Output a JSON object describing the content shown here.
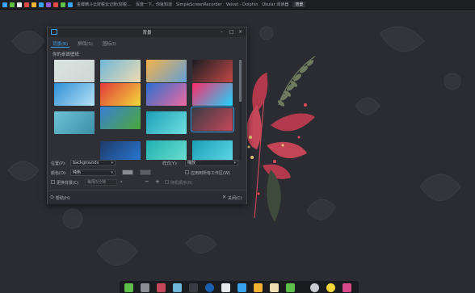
{
  "taskbar": {
    "tasks": [
      "金蝶精斗云财税云记账(财税版)",
      "百度一下，你就知道",
      "SimpleScreenRecorder",
      "Velvet - Dolphin",
      "Okular 阅读器",
      "背景"
    ],
    "active_index": 5,
    "icon_colors": [
      "#3aa3f0",
      "#5fbf4a",
      "#e6e8ec",
      "#e24a4a",
      "#f2b233",
      "#3aa3f0",
      "#8f5bd6",
      "#e24a4a",
      "#5fbf4a",
      "#3aa3f0"
    ]
  },
  "dialog": {
    "title": "背景",
    "tabs": [
      "背景(B)",
      "屏保(S)",
      "图标(I)"
    ],
    "active_tab": 0,
    "section_label": "你的桌面壁纸",
    "thumb_colors": [
      [
        "#d9e4e0",
        "#cfd6d5"
      ],
      [
        "#6fb7d8",
        "#f0dcb1"
      ],
      [
        "#f4b24a",
        "#62a0d8"
      ],
      [
        "#1c1e22",
        "#c24848"
      ],
      [
        "#2f8fd6",
        "#b6e2f6"
      ],
      [
        "#e23a3a",
        "#f2d83a"
      ],
      [
        "#2a6fd0",
        "#f06aa0"
      ],
      [
        "#ff2a6a",
        "#1cd7ff"
      ],
      [
        "#6ec1d6",
        "#3c8fa8"
      ],
      [
        "#3a7fd6",
        "#4aa83a"
      ],
      [
        "#1b9fb6",
        "#6fe0e0"
      ],
      [
        "#3a3c44",
        "#c7475a"
      ],
      [
        "#1e3a6a",
        "#2a7ad6"
      ],
      [
        "#1fb0b0",
        "#6fe0d0"
      ],
      [
        "#1aa0b6",
        "#60d8e6"
      ],
      [
        "#2a2c32",
        "#2a2c32"
      ]
    ],
    "position_label": "位置(P):",
    "position_value": "backgrounds",
    "style_label": "样式(Y):",
    "style_value": "缩放",
    "color_label": "颜色(O):",
    "color_value": "纯色",
    "color1": "#8a8d93",
    "color2": "#5c5f66",
    "all_workspaces_label": "应用到所有工作区(W)",
    "auto_change_label": "更换背景(C)",
    "interval_value": "每隔5分钟",
    "random_label": "随机顺序(R)",
    "help_label": "帮助(H)",
    "close_label": "关闭(C)"
  },
  "colors": {
    "accent": "#3aa3f0"
  }
}
